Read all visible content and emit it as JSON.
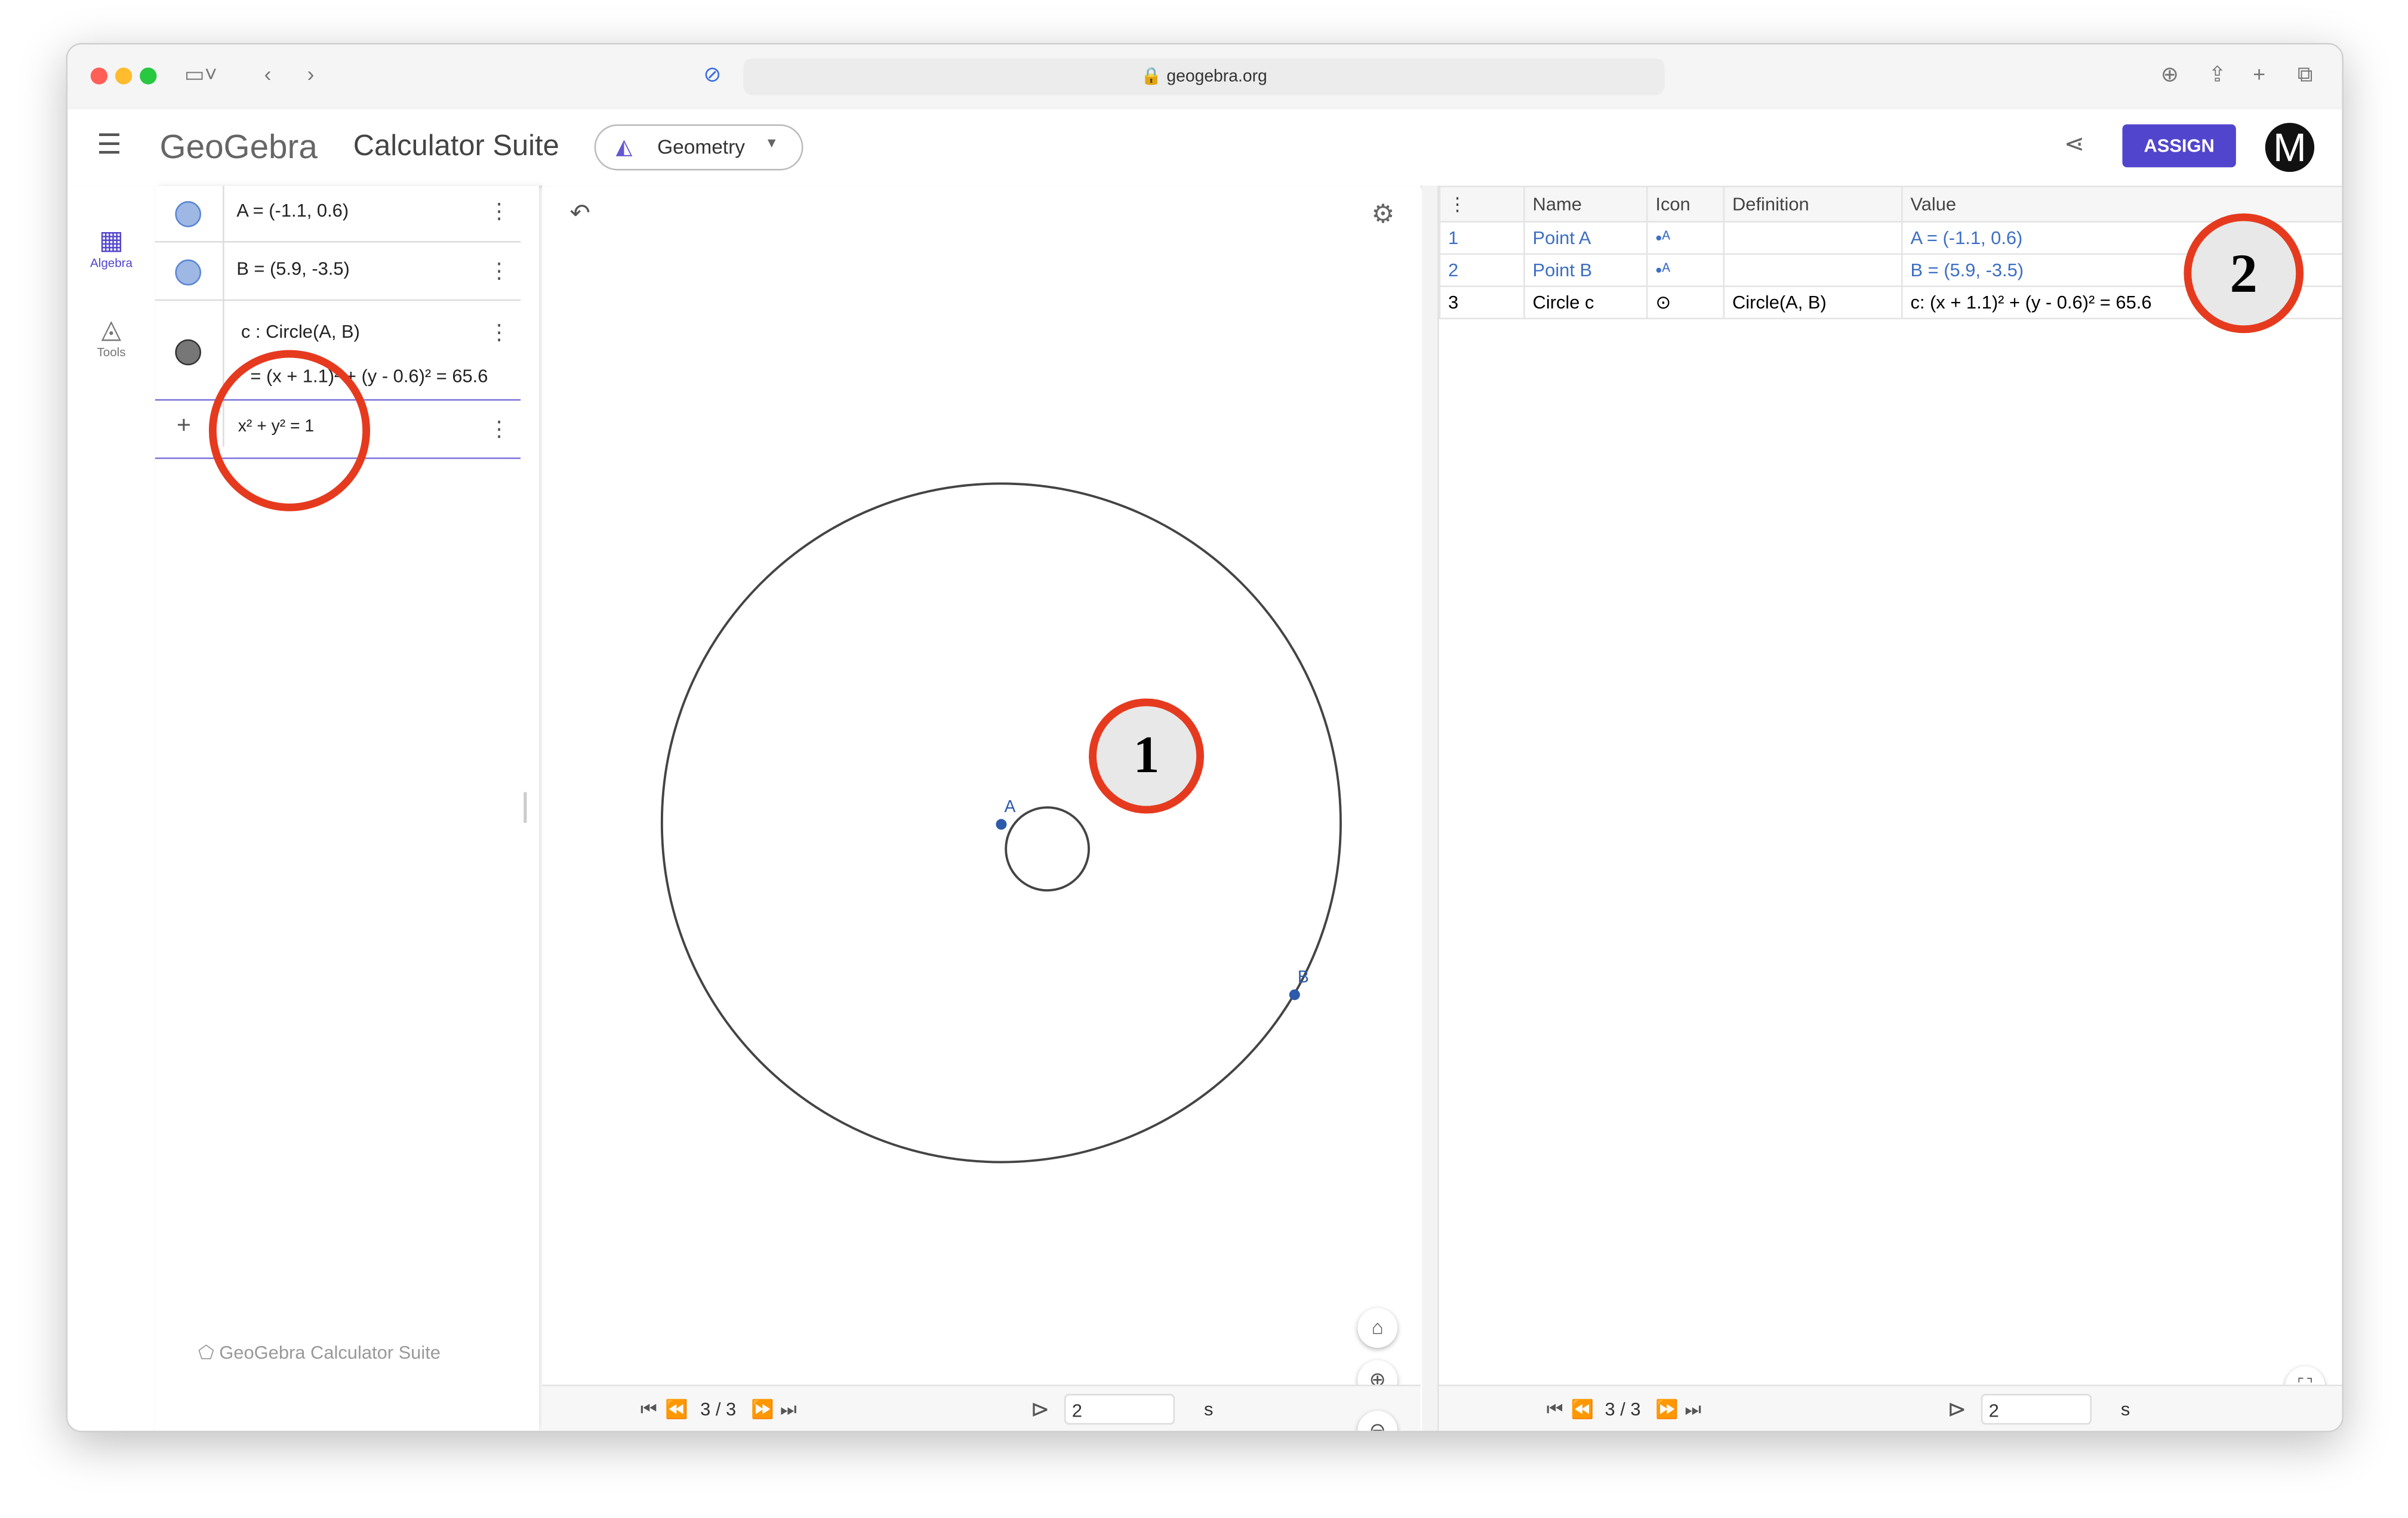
{
  "browser": {
    "url": "geogebra.org"
  },
  "header": {
    "logo": "GeoGebra",
    "title": "Calculator Suite",
    "app_selector": "Geometry",
    "assign_label": "ASSIGN",
    "avatar_letter": "M"
  },
  "sidebar": {
    "items": [
      {
        "label": "Algebra",
        "icon": "calculator-icon",
        "active": true
      },
      {
        "label": "Tools",
        "icon": "shapes-icon"
      }
    ]
  },
  "algebra": {
    "items": [
      {
        "text": "A = (-1.1, 0.6)",
        "color": "#9fb8e3"
      },
      {
        "text": "B = (5.9, -3.5)",
        "color": "#9fb8e3"
      },
      {
        "text": "c : Circle(A, B)",
        "value": "= (x + 1.1)² + (y - 0.6)² = 65.6",
        "color": "#777777"
      }
    ],
    "input": "x² + y² = 1",
    "footer": "GeoGebra Calculator Suite"
  },
  "graphics": {
    "point_labels": [
      "A",
      "B"
    ],
    "player": {
      "step": "3 / 3",
      "speed": "2",
      "unit": "s"
    }
  },
  "construction": {
    "headers": [
      "Name",
      "Icon",
      "Definition",
      "Value"
    ],
    "rows": [
      {
        "no": "1",
        "name": "Point A",
        "definition": "",
        "value": "A = (-1.1, 0.6)"
      },
      {
        "no": "2",
        "name": "Point B",
        "definition": "",
        "value": "B = (5.9, -3.5)"
      },
      {
        "no": "3",
        "name": "Circle c",
        "definition": "Circle(A, B)",
        "value": "c: (x + 1.1)² + (y - 0.6)² = 65.6"
      }
    ],
    "player": {
      "step": "3 / 3",
      "speed": "2",
      "unit": "s"
    }
  },
  "annotations": {
    "one": "1",
    "two": "2"
  },
  "colors": {
    "accent": "#5145cd",
    "point": "#2e5aac",
    "annotation": "#e63a1f"
  }
}
